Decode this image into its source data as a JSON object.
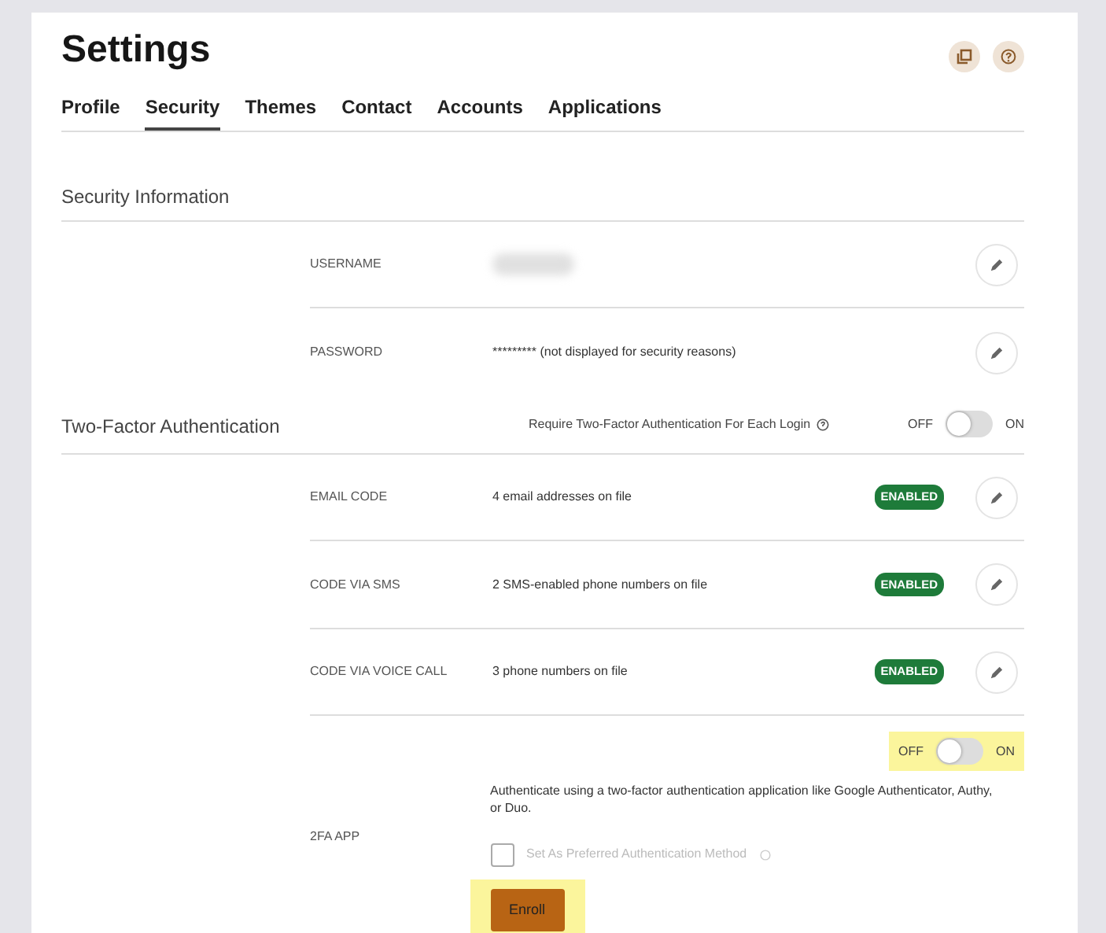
{
  "title": "Settings",
  "tabs": [
    {
      "label": "Profile",
      "selected": false
    },
    {
      "label": "Security",
      "selected": true
    },
    {
      "label": "Themes",
      "selected": false
    },
    {
      "label": "Contact",
      "selected": false
    },
    {
      "label": "Accounts",
      "selected": false
    },
    {
      "label": "Applications",
      "selected": false
    }
  ],
  "security_information": {
    "heading": "Security Information",
    "rows": [
      {
        "label": "USERNAME",
        "value_redacted": true
      },
      {
        "label": "PASSWORD",
        "value": "********* (not displayed for security reasons)"
      }
    ]
  },
  "two_factor": {
    "heading": "Two-Factor Authentication",
    "require_label": "Require Two-Factor Authentication For Each Login",
    "require_toggle": {
      "off_label": "OFF",
      "on_label": "ON",
      "on": false
    },
    "methods": [
      {
        "label": "EMAIL CODE",
        "value": "4 email addresses on file",
        "badge": "ENABLED"
      },
      {
        "label": "CODE VIA SMS",
        "value": "2 SMS-enabled phone numbers on file",
        "badge": "ENABLED"
      },
      {
        "label": "CODE VIA VOICE CALL",
        "value": "3 phone numbers on file",
        "badge": "ENABLED"
      }
    ],
    "app": {
      "label": "2FA APP",
      "toggle": {
        "off_label": "OFF",
        "on_label": "ON",
        "on": false,
        "highlighted": true
      },
      "description": "Authenticate using a two-factor authentication application like Google Authenticator, Authy, or Duo.",
      "preferred_checkbox": {
        "label": "Set As Preferred Authentication Method",
        "checked": false,
        "disabled": true
      },
      "enroll_button": {
        "label": "Enroll",
        "highlighted": true
      }
    }
  }
}
